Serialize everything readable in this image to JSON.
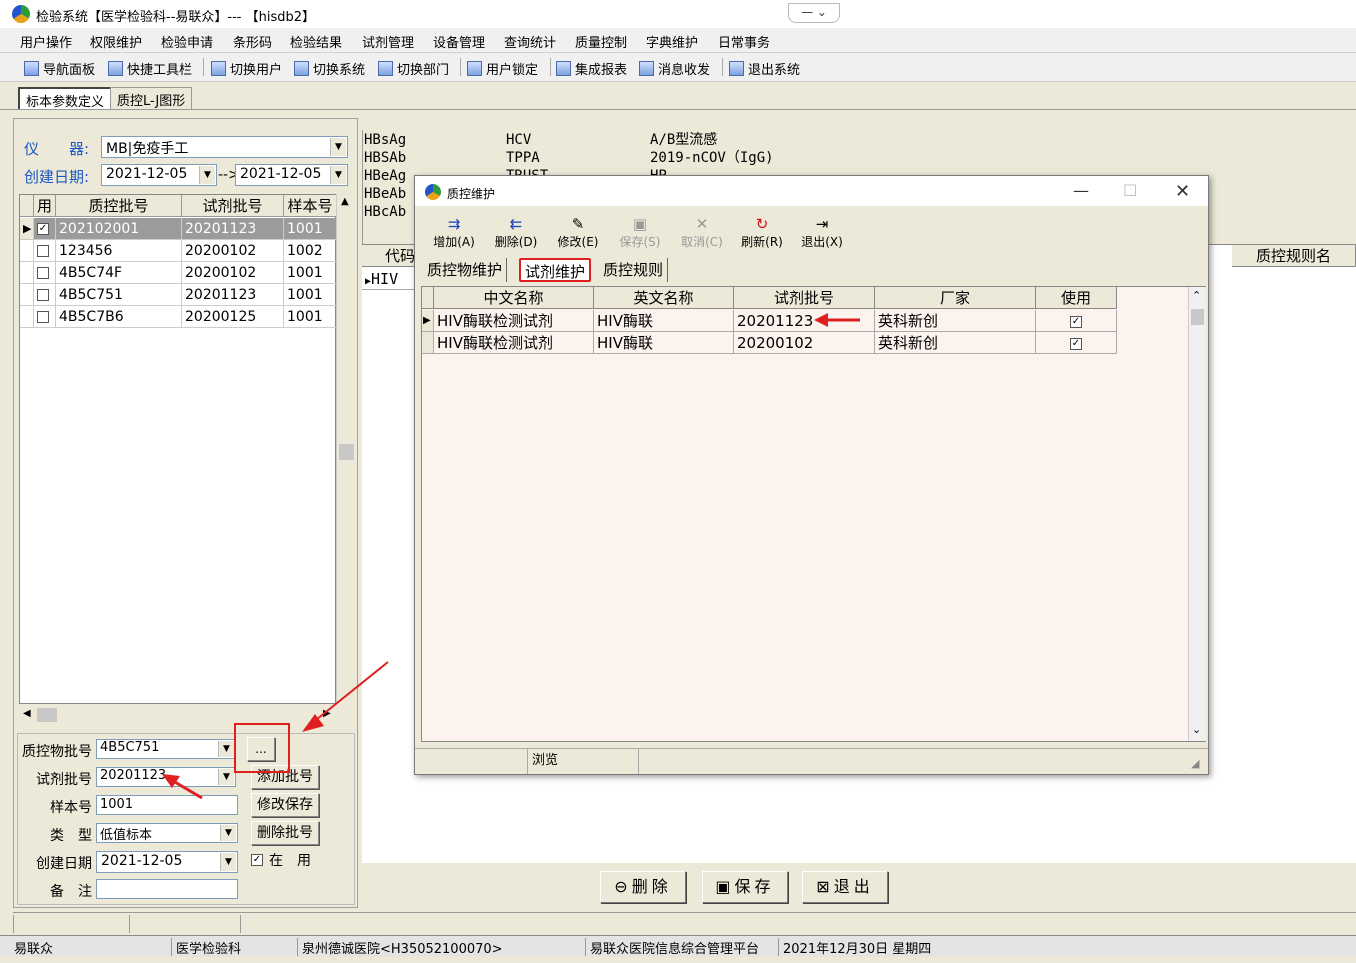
{
  "window": {
    "title": "检验系统【医学检验科--易联众】--- 【hisdb2】",
    "controls": "— ⌄"
  },
  "menu": [
    "用户操作",
    "权限维护",
    "检验申请",
    "条形码",
    "检验结果",
    "试剂管理",
    "设备管理",
    "查询统计",
    "质量控制",
    "字典维护",
    "日常事务"
  ],
  "toolbar": [
    "导航面板",
    "快捷工具栏",
    "切换用户",
    "切换系统",
    "切换部门",
    "用户锁定",
    "集成报表",
    "消息收发",
    "退出系统"
  ],
  "tabs": [
    "标本参数定义",
    "质控L-J图形"
  ],
  "left": {
    "instrument_label": "仪　　器:",
    "instrument_value": "MB|免疫手工",
    "date_label": "创建日期:",
    "date_from": "2021-12-05",
    "date_sep": "-->",
    "date_to": "2021-12-05",
    "columns": [
      "用",
      "质控批号",
      "试剂批号",
      "样本号"
    ],
    "rows": [
      {
        "checked": true,
        "lot": "202102001",
        "reagent": "20201123",
        "sample": "1001"
      },
      {
        "checked": false,
        "lot": "123456",
        "reagent": "20200102",
        "sample": "1002"
      },
      {
        "checked": false,
        "lot": "4B5C74F",
        "reagent": "20200102",
        "sample": "1001"
      },
      {
        "checked": false,
        "lot": "4B5C751",
        "reagent": "20201123",
        "sample": "1001"
      },
      {
        "checked": false,
        "lot": "4B5C7B6",
        "reagent": "20200125",
        "sample": "1001"
      }
    ]
  },
  "form": {
    "qc_lot_label": "质控物批号",
    "qc_lot": "4B5C751",
    "reagent_lot_label": "试剂批号",
    "reagent_lot": "20201123",
    "sample_label": "样本号",
    "sample": "1001",
    "type_label": "类　型",
    "type": "低值标本",
    "date_label": "创建日期",
    "date": "2021-12-05",
    "note_label": "备　注",
    "note": "",
    "ellipsis": "...",
    "add_btn": "添加批号",
    "save_btn": "修改保存",
    "delete_btn": "删除批号",
    "in_use_label": "在　用"
  },
  "codes": {
    "col1": [
      "HBsAg",
      "HBSAb",
      "HBeAg",
      "HBeAb",
      "HBcAb"
    ],
    "col2": [
      "HCV",
      "TPPA",
      "TRUST"
    ],
    "col3": [
      "A/B型流感",
      "2019-nCOV（IgG)",
      "HP"
    ],
    "code_header": "代码",
    "code_row": "HIV",
    "rule_header": "质控规则名"
  },
  "bottom_buttons": [
    "删除",
    "保存",
    "退出"
  ],
  "status1": [
    "",
    "",
    ""
  ],
  "status2": [
    "易联众",
    "医学检验科",
    "泉州德诚医院<H35052100070>",
    "易联众医院信息综合管理平台",
    "2021年12月30日 星期四"
  ],
  "dialog": {
    "title": "质控维护",
    "toolbar": [
      {
        "label": "增加(A)",
        "icon": "add-icon",
        "enabled": true
      },
      {
        "label": "删除(D)",
        "icon": "delete-icon",
        "enabled": true
      },
      {
        "label": "修改(E)",
        "icon": "edit-icon",
        "enabled": true
      },
      {
        "label": "保存(S)",
        "icon": "save-icon",
        "enabled": false
      },
      {
        "label": "取消(C)",
        "icon": "cancel-icon",
        "enabled": false
      },
      {
        "label": "刷新(R)",
        "icon": "refresh-icon",
        "enabled": true
      },
      {
        "label": "退出(X)",
        "icon": "exit-icon",
        "enabled": true
      }
    ],
    "tabs": [
      "质控物维护",
      "试剂维护",
      "质控规则"
    ],
    "columns": [
      "中文名称",
      "英文名称",
      "试剂批号",
      "厂家",
      "使用"
    ],
    "rows": [
      {
        "cn": "HIV酶联检测试剂",
        "en": "HIV酶联",
        "lot": "20201123",
        "vendor": "英科新创",
        "use": true
      },
      {
        "cn": "HIV酶联检测试剂",
        "en": "HIV酶联",
        "lot": "20200102",
        "vendor": "英科新创",
        "use": true
      }
    ],
    "status": "浏览"
  },
  "colors": {
    "accent_red": "#e02020",
    "label_blue": "#1a57c5",
    "grid_row_bg": "#fdf3ee"
  }
}
